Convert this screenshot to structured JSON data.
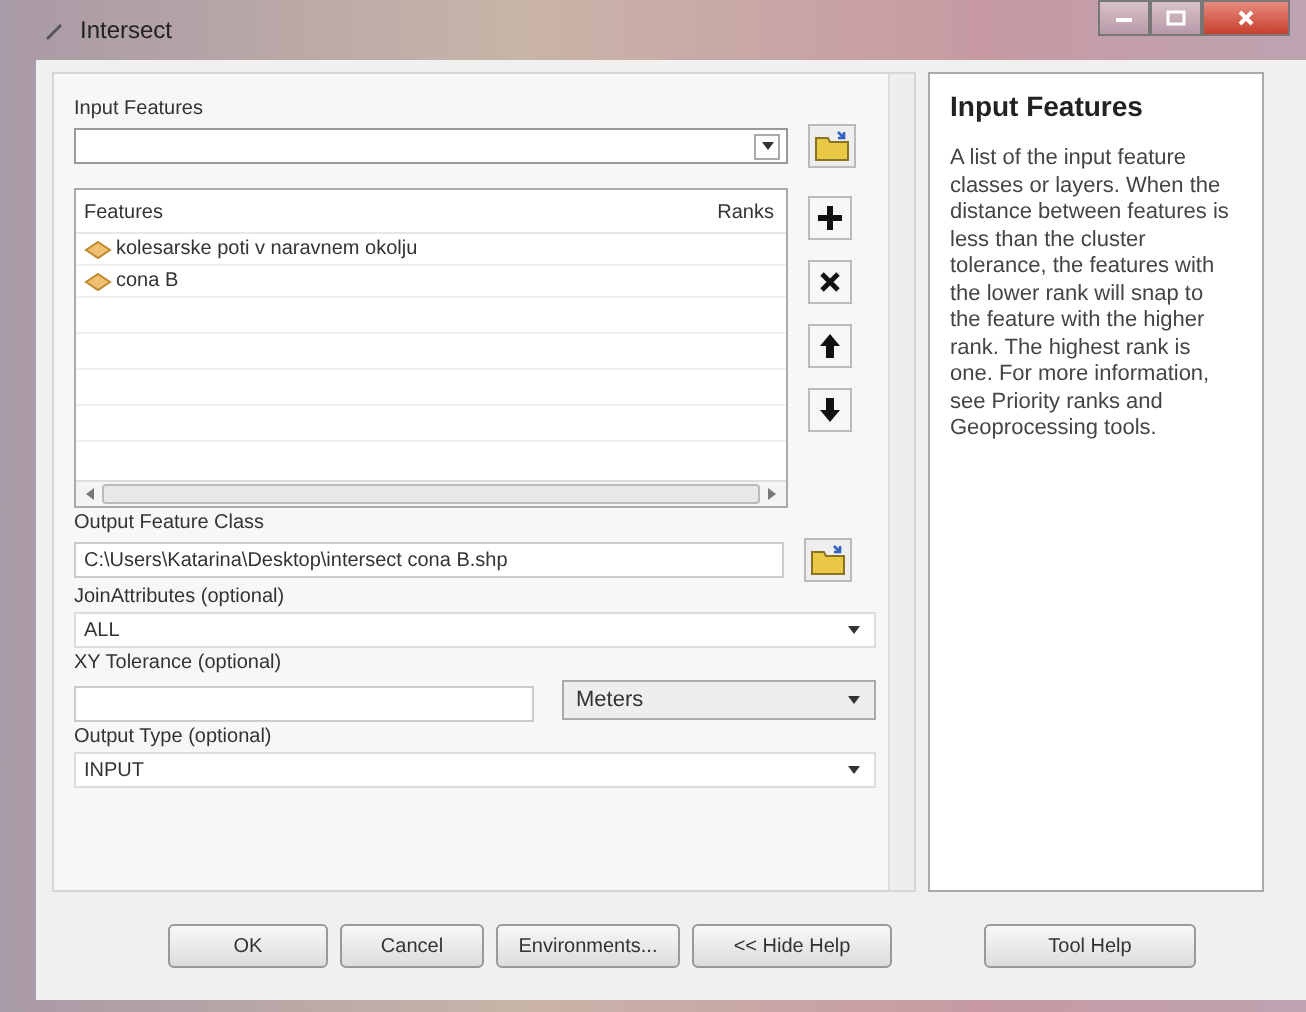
{
  "window": {
    "title": "Intersect"
  },
  "form": {
    "input_features": {
      "label": "Input Features"
    },
    "features_list": {
      "columns": [
        "Features",
        "Ranks"
      ],
      "rows": [
        {
          "name": "kolesarske poti v naravnem okolju"
        },
        {
          "name": "cona B"
        }
      ]
    },
    "output_feature_class": {
      "label": "Output Feature Class",
      "value": "C:\\Users\\Katarina\\Desktop\\intersect cona B.shp"
    },
    "join_attributes": {
      "label": "JoinAttributes (optional)",
      "value": "ALL"
    },
    "xy_tolerance": {
      "label": "XY Tolerance (optional)",
      "unit": "Meters"
    },
    "output_type": {
      "label": "Output Type (optional)",
      "value": "INPUT"
    }
  },
  "help": {
    "title": "Input Features",
    "text": "A list of the input feature classes or layers. When the distance between features is less than the cluster tolerance, the features with the lower rank will snap to the feature with the higher rank. The highest rank is one. For more information, see Priority ranks and Geoprocessing tools."
  },
  "buttons": [
    "OK",
    "Cancel",
    "Environments...",
    "<< Hide Help"
  ],
  "tool_help_button": "Tool Help"
}
